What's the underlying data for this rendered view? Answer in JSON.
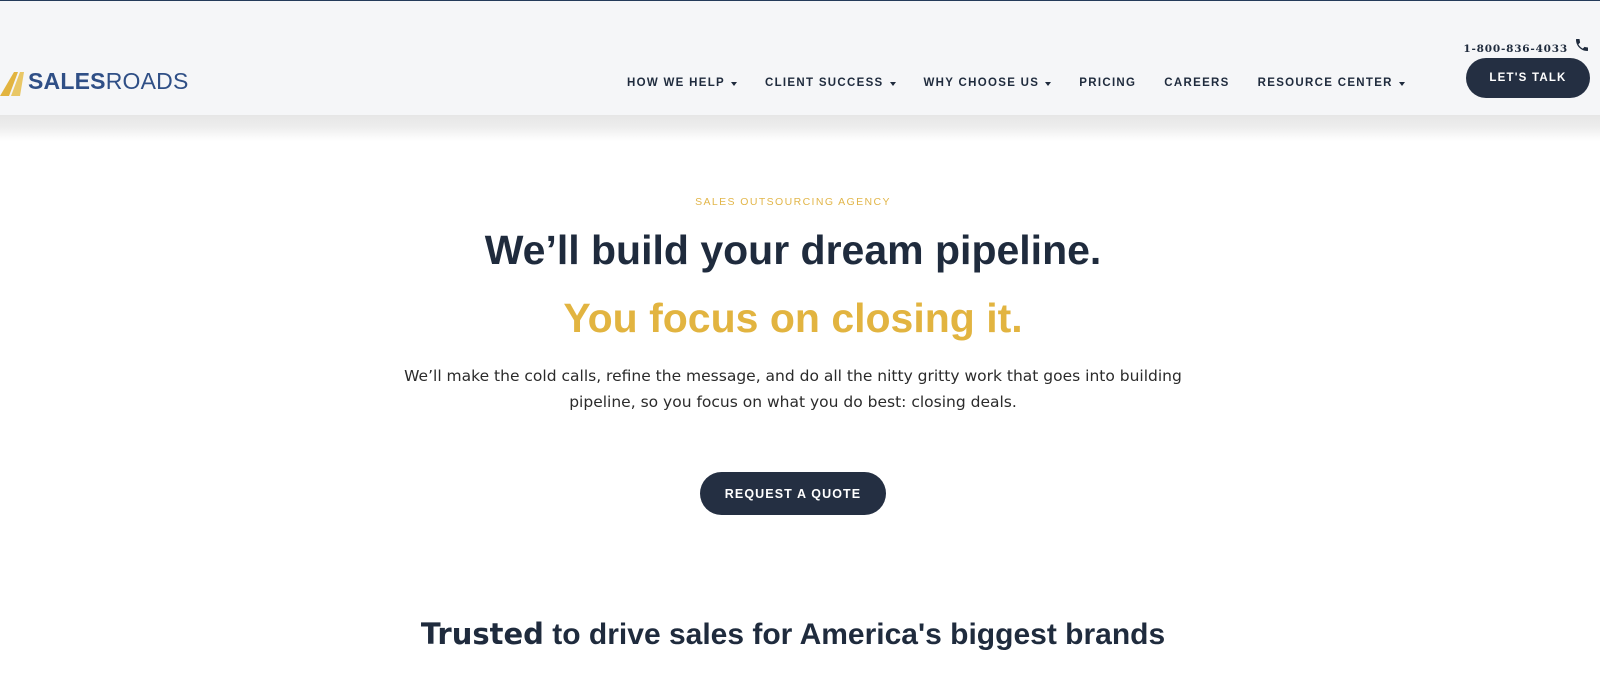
{
  "brand": {
    "logo_strong": "SALES",
    "logo_light": "ROADS",
    "colors": {
      "navy": "#242f42",
      "gold": "#e2b440",
      "logo_blue": "#2f4f86",
      "header_bg": "#f5f6f8"
    }
  },
  "nav": {
    "items": [
      {
        "label": "HOW WE HELP",
        "has_dropdown": true
      },
      {
        "label": "CLIENT SUCCESS",
        "has_dropdown": true
      },
      {
        "label": "WHY CHOOSE US",
        "has_dropdown": true
      },
      {
        "label": "PRICING",
        "has_dropdown": false
      },
      {
        "label": "CAREERS",
        "has_dropdown": false
      },
      {
        "label": "RESOURCE CENTER",
        "has_dropdown": true
      }
    ]
  },
  "header": {
    "phone": "1-800-836-4033",
    "phone_icon": "phone-icon",
    "cta_label": "LET'S TALK"
  },
  "hero": {
    "eyebrow": "SALES OUTSOURCING AGENCY",
    "headline": "We’ll build your dream pipeline.",
    "subheadline": "You focus on closing it.",
    "body": "We’ll make the cold calls, refine the message, and do all the nitty gritty work that goes into building pipeline, so you focus on what you do best: closing deals.",
    "cta_label": "REQUEST A QUOTE"
  },
  "trusted": {
    "bold": "Trusted",
    "rest": " to drive sales for America's biggest brands"
  }
}
